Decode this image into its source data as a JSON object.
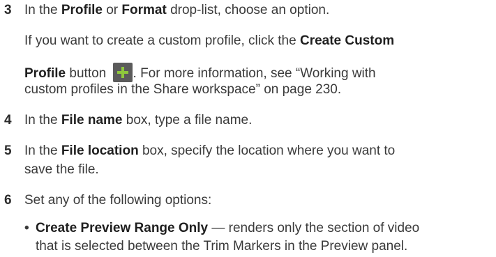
{
  "steps": {
    "s3": {
      "num": "3",
      "a": "In the ",
      "b1": "Profile",
      "c": " or ",
      "b2": "Format",
      "d": " drop-list, choose an option.",
      "p1": "If you want to create a custom profile, click the ",
      "p1b": "Create Custom",
      "p2b": "Profile",
      "p2": " button ",
      "p2c": ". For more information, see “Working with",
      "p3": "custom profiles in the Share workspace” on page 230."
    },
    "s4": {
      "num": "4",
      "a": "In the ",
      "b": "File name",
      "c": " box, type a file name."
    },
    "s5": {
      "num": "5",
      "a": "In the ",
      "b": "File location",
      "c": " box, specify the location where you want to",
      "d": "save the file."
    },
    "s6": {
      "num": "6",
      "a": "Set any of the following options:",
      "bullet": "•",
      "ob": "Create Preview Range Only",
      "o1": " — renders only the section of video",
      "o2": "that is selected between the Trim Markers in the Preview panel."
    }
  },
  "icons": {
    "create_custom_profile": "plus-icon"
  },
  "colors": {
    "text": "#3a3a3a",
    "icon_bg": "#5b5b5b",
    "icon_plus": "#8fc83c"
  }
}
